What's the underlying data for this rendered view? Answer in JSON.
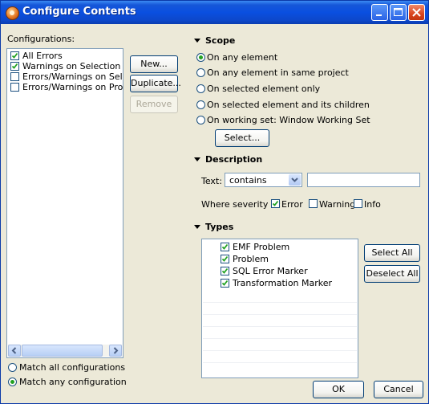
{
  "window": {
    "title": "Configure Contents"
  },
  "configurations": {
    "label": "Configurations:",
    "items": [
      {
        "label": "All Errors",
        "checked": true
      },
      {
        "label": "Warnings on Selection",
        "checked": true
      },
      {
        "label": "Errors/Warnings on Selec",
        "checked": false
      },
      {
        "label": "Errors/Warnings on Proje",
        "checked": false
      }
    ],
    "buttons": {
      "new": "New...",
      "duplicate": "Duplicate...",
      "remove": "Remove"
    },
    "match": {
      "all": "Match all configurations",
      "any": "Match any configuration",
      "selected": "any"
    }
  },
  "scope": {
    "title": "Scope",
    "options": [
      "On any element",
      "On any element in same project",
      "On selected element only",
      "On selected element and its children",
      "On working set:  Window Working Set"
    ],
    "selected_index": 0,
    "select_button": "Select..."
  },
  "description": {
    "title": "Description",
    "text_label": "Text:",
    "operator": "contains",
    "text_value": "",
    "severity_label": "Where severity is:",
    "severities": [
      {
        "label": "Error",
        "checked": true
      },
      {
        "label": "Warning",
        "checked": false
      },
      {
        "label": "Info",
        "checked": false
      }
    ]
  },
  "types": {
    "title": "Types",
    "items": [
      {
        "label": "EMF Problem",
        "checked": true
      },
      {
        "label": "Problem",
        "checked": true
      },
      {
        "label": "SQL Error Marker",
        "checked": true
      },
      {
        "label": "Transformation Marker",
        "checked": true
      }
    ],
    "select_all": "Select All",
    "deselect_all": "Deselect All"
  },
  "footer": {
    "ok": "OK",
    "cancel": "Cancel"
  },
  "colors": {
    "titlebar": "#0a4fe0",
    "dialog_bg": "#ece9d8",
    "check_mark": "#21a121"
  }
}
